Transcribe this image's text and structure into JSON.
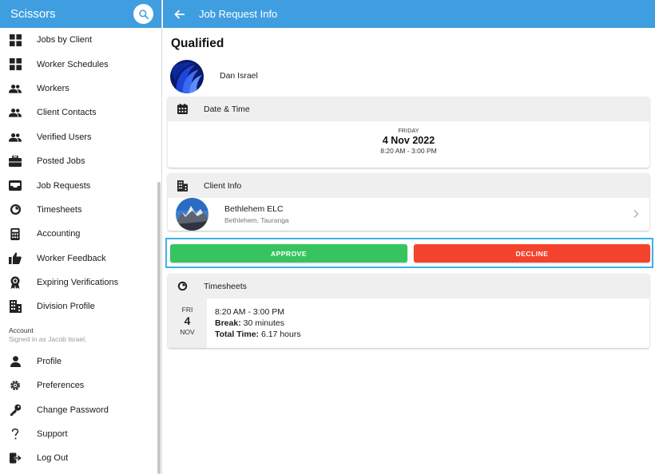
{
  "sidebar": {
    "title": "Scissors",
    "items": [
      {
        "label": "Jobs by Client",
        "icon": "grid-icon"
      },
      {
        "label": "Worker Schedules",
        "icon": "grid-icon"
      },
      {
        "label": "Workers",
        "icon": "people-icon"
      },
      {
        "label": "Client Contacts",
        "icon": "people-icon"
      },
      {
        "label": "Verified Users",
        "icon": "people-icon"
      },
      {
        "label": "Posted Jobs",
        "icon": "briefcase-icon"
      },
      {
        "label": "Job Requests",
        "icon": "inbox-icon"
      },
      {
        "label": "Timesheets",
        "icon": "stopwatch-icon"
      },
      {
        "label": "Accounting",
        "icon": "calculator-icon"
      },
      {
        "label": "Worker Feedback",
        "icon": "thumbs-up-icon"
      },
      {
        "label": "Expiring Verifications",
        "icon": "award-icon"
      },
      {
        "label": "Division Profile",
        "icon": "building-icon"
      }
    ],
    "account": {
      "heading": "Account",
      "signed_in": "Signed in as Jacob Israel."
    },
    "account_items": [
      {
        "label": "Profile",
        "icon": "person-icon"
      },
      {
        "label": "Preferences",
        "icon": "settings-icon"
      },
      {
        "label": "Change Password",
        "icon": "key-icon"
      },
      {
        "label": "Support",
        "icon": "question-icon"
      },
      {
        "label": "Log Out",
        "icon": "logout-icon"
      }
    ]
  },
  "header": {
    "title": "Job Request Info"
  },
  "request": {
    "status": "Qualified",
    "worker_name": "Dan Israel"
  },
  "datetime": {
    "heading": "Date & Time",
    "day": "FRIDAY",
    "date": "4 Nov 2022",
    "time": "8:20 AM - 3:00 PM"
  },
  "client": {
    "heading": "Client Info",
    "name": "Bethlehem ELC",
    "location": "Bethlehem, Tauranga"
  },
  "actions": {
    "approve": "APPROVE",
    "decline": "DECLINE"
  },
  "timesheets": {
    "heading": "Timesheets",
    "entry": {
      "weekday": "FRI",
      "day": "4",
      "month": "NOV",
      "time": "8:20 AM - 3:00 PM",
      "break_label": "Break:",
      "break_value": " 30 minutes",
      "total_label": "Total Time:",
      "total_value": " 6.17 hours"
    }
  },
  "colors": {
    "primary": "#3f9ee0",
    "approve": "#36c460",
    "decline": "#f4432c",
    "highlight": "#3fb0e8"
  }
}
